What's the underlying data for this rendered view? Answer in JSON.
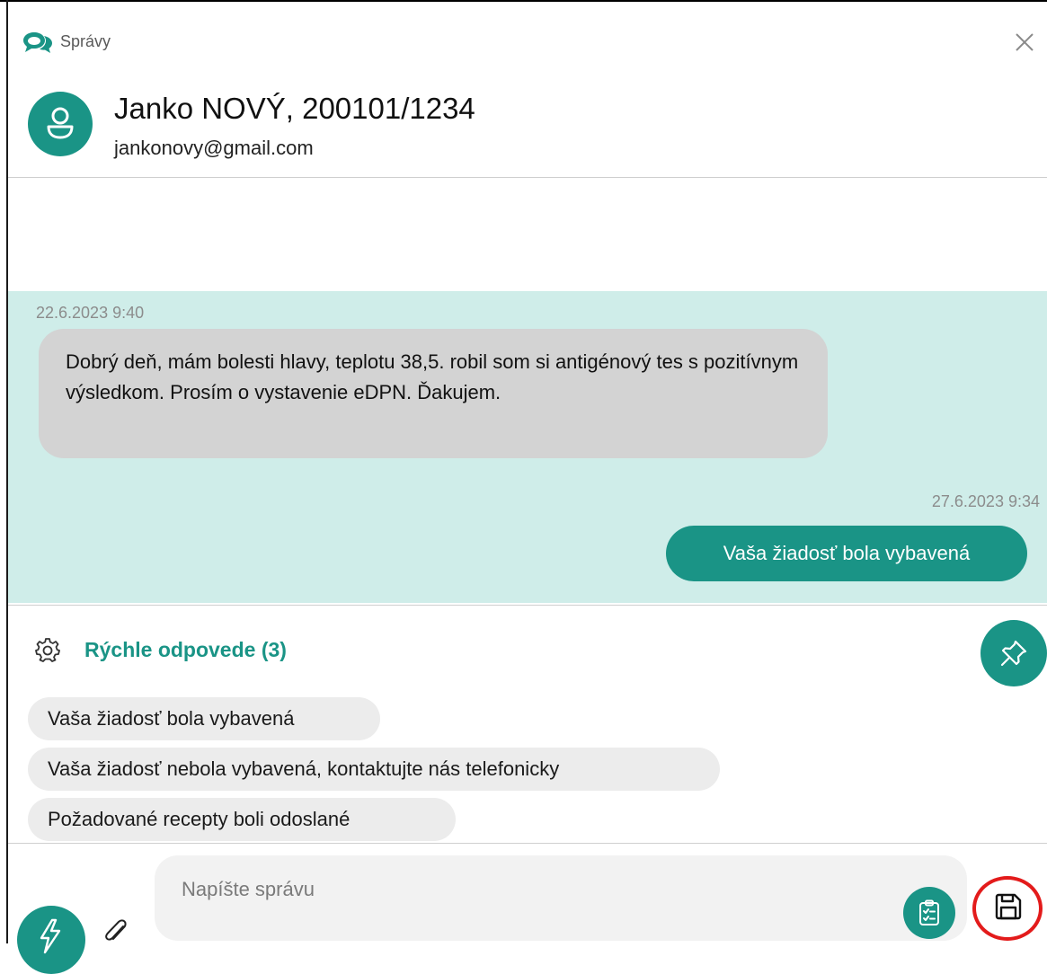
{
  "window": {
    "title": "Správy",
    "icons": {
      "app": "chat-bubbles-icon",
      "close": "close-icon"
    }
  },
  "patient": {
    "name": "Janko NOVÝ, 200101/1234",
    "email": "jankonovy@gmail.com",
    "avatar_icon": "person-icon"
  },
  "messages": [
    {
      "direction": "incoming",
      "timestamp": "22.6.2023  9:40",
      "text": "Dobrý deň, mám bolesti hlavy, teplotu 38,5.  robil som si antigénový tes s pozitívnym výsledkom. Prosím o vystavenie eDPN. Ďakujem."
    },
    {
      "direction": "outgoing",
      "timestamp": "27.6.2023  9:34",
      "text": "Vaša žiadosť bola vybavená"
    }
  ],
  "quick_replies": {
    "title": "Rýchle odpovede (3)",
    "settings_icon": "gear-icon",
    "pin_icon": "pin-icon",
    "items": [
      "Vaša žiadosť bola vybavená",
      "Vaša žiadosť nebola vybavená, kontaktujte nás telefonicky",
      "Požadované recepty boli odoslané"
    ]
  },
  "composer": {
    "placeholder": "Napíšte správu",
    "value": "",
    "icons": {
      "quick": "lightning-icon",
      "attach": "paperclip-icon",
      "checklist": "checklist-icon",
      "save": "floppy-disk-icon"
    }
  },
  "colors": {
    "accent": "#1a9486",
    "chat_background": "#cfede9",
    "incoming_bubble": "#d3d3d3",
    "chip_background": "#ececec",
    "highlight_ring": "#e31b1b"
  }
}
